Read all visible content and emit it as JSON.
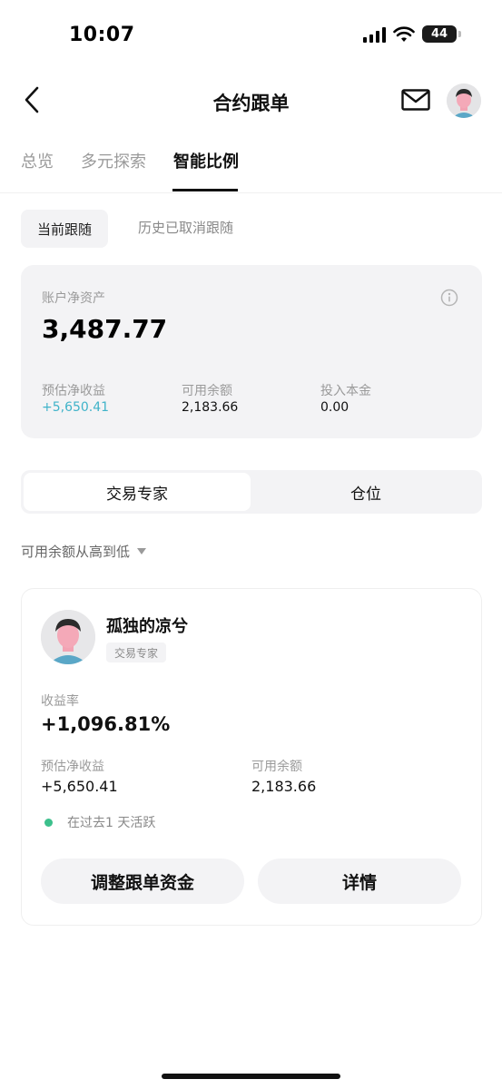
{
  "status_bar": {
    "time": "10:07",
    "battery": "44"
  },
  "header": {
    "title": "合约跟单"
  },
  "tabs": [
    {
      "label": "总览"
    },
    {
      "label": "多元探索"
    },
    {
      "label": "智能比例"
    }
  ],
  "sub_tabs": [
    {
      "label": "当前跟随"
    },
    {
      "label": "历史已取消跟随"
    }
  ],
  "account": {
    "label": "账户净资产",
    "value": "3,487.77",
    "stats": [
      {
        "label": "预估净收益",
        "value": "+5,650.41"
      },
      {
        "label": "可用余额",
        "value": "2,183.66"
      },
      {
        "label": "投入本金",
        "value": "0.00"
      }
    ]
  },
  "segments": [
    {
      "label": "交易专家"
    },
    {
      "label": "仓位"
    }
  ],
  "sort": {
    "label": "可用余额从高到低"
  },
  "trader": {
    "name": "孤独的凉兮",
    "tag": "交易专家",
    "roi_label": "收益率",
    "roi_value": "+1,096.81%",
    "profit_label": "预估净收益",
    "profit_value": "+5,650.41",
    "balance_label": "可用余额",
    "balance_value": "2,183.66",
    "active_text": "在过去1 天活跃",
    "adjust_button": "调整跟单资金",
    "detail_button": "详情"
  },
  "colors": {
    "positive": "#3fb3c9",
    "active_dot": "#3cc08c",
    "card_bg": "#f3f3f5"
  }
}
